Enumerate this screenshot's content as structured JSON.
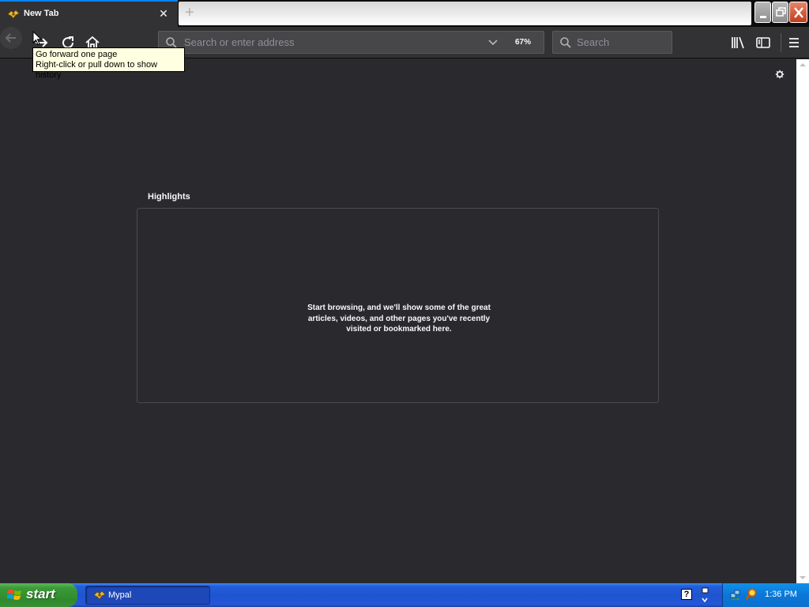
{
  "window": {
    "tab": {
      "title": "New Tab",
      "favicon": "mypal-favicon"
    },
    "new_tab_icon": "plus-icon",
    "caption_buttons": [
      "minimize-icon",
      "restore-icon",
      "close-icon"
    ]
  },
  "toolbar": {
    "nav_icons": [
      "back-arrow-icon",
      "forward-arrow-icon",
      "reload-icon",
      "home-icon"
    ],
    "url": {
      "placeholder": "Search or enter address",
      "value": "",
      "zoom": "67%"
    },
    "search": {
      "placeholder": "Search",
      "value": ""
    },
    "right_icons": [
      "library-icon",
      "sidebar-icon",
      "hamburger-menu-icon"
    ]
  },
  "tooltip": {
    "line1": "Go forward one page",
    "line2": "Right-click or pull down to show history"
  },
  "content": {
    "settings_icon": "gear-icon",
    "highlights": {
      "title": "Highlights",
      "empty_message_1": "Start browsing, and we'll show some of the great",
      "empty_message_2": "articles, videos, and other pages you've recently",
      "empty_message_3": "visited or bookmarked here."
    }
  },
  "taskbar": {
    "start_label": "start",
    "tasks": [
      {
        "label": "Mypal",
        "icon": "mypal-favicon"
      }
    ],
    "help_label": "?",
    "clock": "1:36 PM"
  },
  "colors": {
    "tab_accent": "#0a84ff",
    "toolbar_bg": "#323234",
    "content_bg": "#2a2a2e",
    "taskbar_blue": "#245edb",
    "start_green": "#3c9a39"
  }
}
